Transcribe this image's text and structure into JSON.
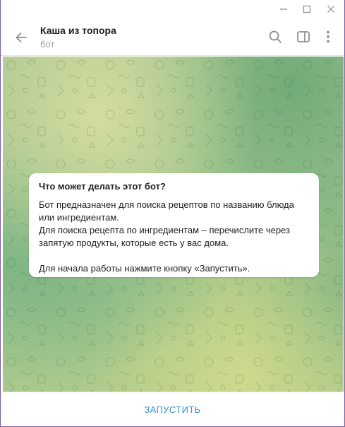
{
  "window": {
    "controls": {
      "minimize_icon": "minimize-icon",
      "maximize_icon": "maximize-icon",
      "close_icon": "close-icon"
    }
  },
  "header": {
    "title": "Каша из топора",
    "subtitle": "бот",
    "back_icon": "arrow-left-icon",
    "search_icon": "search-icon",
    "sidebar_icon": "sidebar-toggle-icon",
    "more_icon": "more-vertical-icon"
  },
  "info_card": {
    "title": "Что может делать этот бот?",
    "lines": [
      "Бот предназначен для поиска рецептов по названию блюда",
      "или ингредиентам.",
      "Для поиска рецепта по ингредиентам – перечислите через",
      "запятую продукты, которые есть у вас дома.",
      "",
      "Для начала работы нажмите кнопку «Запустить»."
    ]
  },
  "bottom": {
    "start_label": "ЗАПУСТИТЬ"
  },
  "colors": {
    "accent": "#3a8fd4",
    "window_border": "#7b5fa6",
    "chat_bg_green": "#9cc38d",
    "chat_bg_yellow": "#d6dea0"
  }
}
